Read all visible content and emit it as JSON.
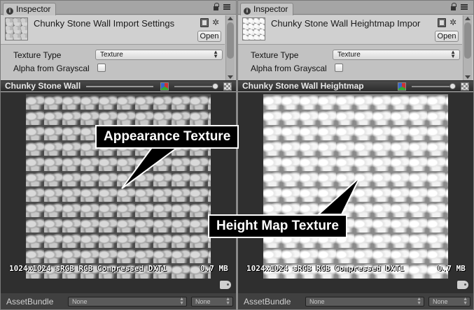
{
  "left": {
    "tab_label": "Inspector",
    "header_title": "Chunky Stone Wall Import Settings",
    "open_label": "Open",
    "fields": {
      "texture_type_label": "Texture Type",
      "texture_type_value": "Texture",
      "alpha_label": "Alpha from Grayscal"
    },
    "preview_title": "Chunky Stone Wall",
    "info": "1024x1024 sRGB  RGB Compressed DXT1",
    "info_size": "0.7 MB",
    "assetbundle_label": "AssetBundle",
    "assetbundle_name": "None",
    "assetbundle_variant": "None"
  },
  "right": {
    "tab_label": "Inspector",
    "header_title": "Chunky Stone Wall Heightmap Impor",
    "open_label": "Open",
    "fields": {
      "texture_type_label": "Texture Type",
      "texture_type_value": "Texture",
      "alpha_label": "Alpha from Grayscal"
    },
    "preview_title": "Chunky Stone Wall Heightmap",
    "info": "1024x1024 sRGB  RGB Compressed DXT1",
    "info_size": "0.7 MB",
    "assetbundle_label": "AssetBundle",
    "assetbundle_name": "None",
    "assetbundle_variant": "None"
  },
  "callouts": {
    "appearance": "Appearance Texture",
    "heightmap": "Height Map Texture"
  },
  "icons": [
    "info-icon",
    "lock-icon",
    "menu-icon",
    "help-book-icon",
    "gear-icon",
    "rgb-channel-icon",
    "checker-alpha-icon",
    "asset-label-tag-icon"
  ]
}
